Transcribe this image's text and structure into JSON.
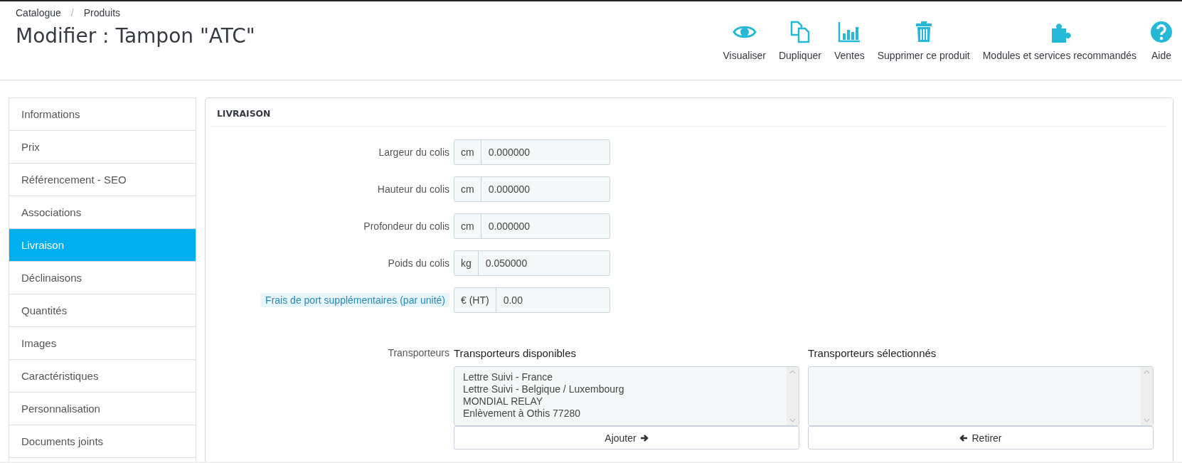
{
  "breadcrumb": {
    "items": [
      "Catalogue",
      "Produits"
    ],
    "separator": "/"
  },
  "title": "Modifier : Tampon \"ATC\"",
  "toolbar": [
    {
      "kind": "eye",
      "label": "Visualiser"
    },
    {
      "kind": "duplicate",
      "label": "Dupliquer"
    },
    {
      "kind": "chart",
      "label": "Ventes"
    },
    {
      "kind": "trash",
      "label": "Supprimer ce produit"
    },
    {
      "kind": "puzzle",
      "label": "Modules et services recommandés"
    },
    {
      "kind": "help",
      "label": "Aide"
    }
  ],
  "sidebar": {
    "items": [
      {
        "label": "Informations",
        "selected": false
      },
      {
        "label": "Prix",
        "selected": false
      },
      {
        "label": "Référencement - SEO",
        "selected": false
      },
      {
        "label": "Associations",
        "selected": false
      },
      {
        "label": "Livraison",
        "selected": true
      },
      {
        "label": "Déclinaisons",
        "selected": false
      },
      {
        "label": "Quantités",
        "selected": false
      },
      {
        "label": "Images",
        "selected": false
      },
      {
        "label": "Caractéristiques",
        "selected": false
      },
      {
        "label": "Personnalisation",
        "selected": false
      },
      {
        "label": "Documents joints",
        "selected": false
      }
    ]
  },
  "panel": {
    "heading": "LIVRAISON",
    "fields": [
      {
        "label": "Largeur du colis",
        "unit": "cm",
        "value": "0.000000",
        "hint": false
      },
      {
        "label": "Hauteur du colis",
        "unit": "cm",
        "value": "0.000000",
        "hint": false
      },
      {
        "label": "Profondeur du colis",
        "unit": "cm",
        "value": "0.000000",
        "hint": false
      },
      {
        "label": "Poids du colis",
        "unit": "kg",
        "value": "0.050000",
        "hint": false
      },
      {
        "label": "Frais de port supplémentaires (par unité)",
        "unit": "€ (HT)",
        "value": "0.00",
        "hint": true
      }
    ],
    "carriers": {
      "label": "Transporteurs",
      "available": {
        "heading": "Transporteurs disponibles",
        "options": [
          "Lettre Suivi - France",
          "Lettre Suivi - Belgique / Luxembourg",
          "MONDIAL RELAY",
          "Enlèvement à Othis 77280"
        ],
        "button": "Ajouter"
      },
      "selected": {
        "heading": "Transporteurs sélectionnés",
        "button": "Retirer"
      }
    }
  }
}
